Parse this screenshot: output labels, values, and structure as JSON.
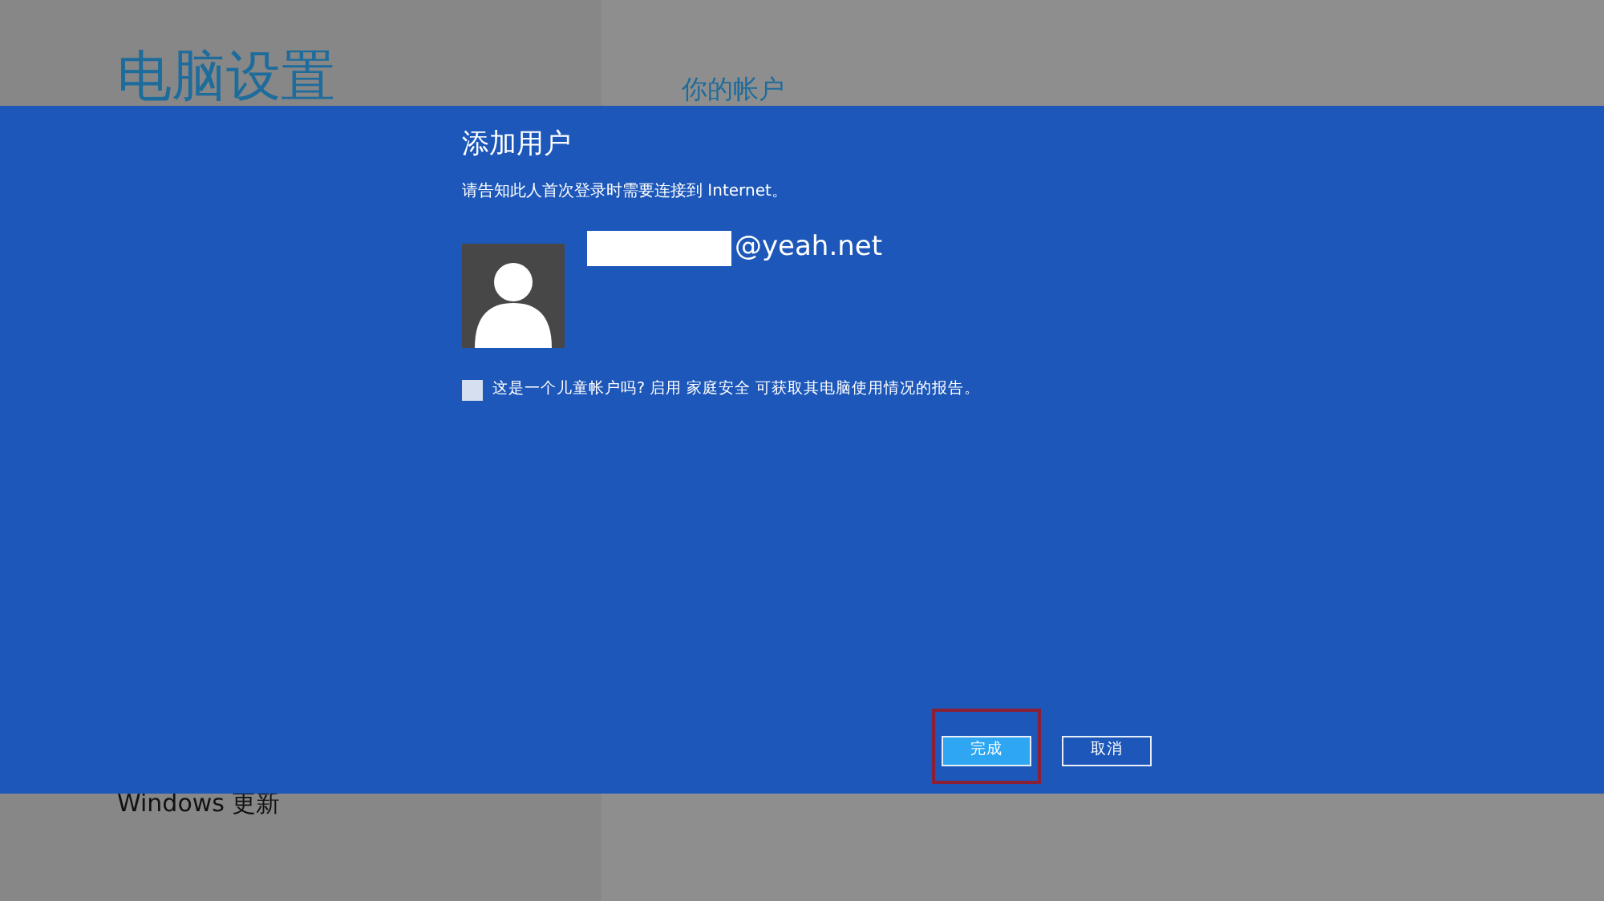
{
  "background": {
    "title": "电脑设置",
    "section_title": "你的帐户",
    "sidebar_items": [
      "Windows 更新"
    ]
  },
  "dialog": {
    "title": "添加用户",
    "subtitle": "请告知此人首次登录时需要连接到 Internet。",
    "email_suffix": "@yeah.net",
    "child_account": {
      "checked": false,
      "label": "这是一个儿童帐户吗? 启用 家庭安全 可获取其电脑使用情况的报告。"
    },
    "buttons": [
      {
        "label": "完成",
        "kind": "primary",
        "highlighted": true
      },
      {
        "label": "取消",
        "kind": "secondary",
        "highlighted": false
      }
    ]
  }
}
